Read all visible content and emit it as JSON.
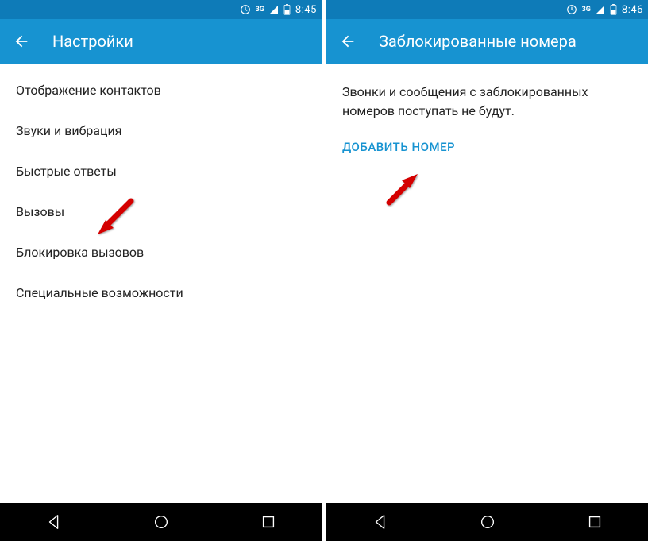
{
  "left": {
    "status": {
      "network": "3G",
      "time": "8:45"
    },
    "appbar": {
      "title": "Настройки"
    },
    "menu": [
      {
        "label": "Отображение контактов"
      },
      {
        "label": "Звуки и вибрация"
      },
      {
        "label": "Быстрые ответы"
      },
      {
        "label": "Вызовы"
      },
      {
        "label": "Блокировка вызовов"
      },
      {
        "label": "Специальные возможности"
      }
    ]
  },
  "right": {
    "status": {
      "network": "3G",
      "time": "8:46"
    },
    "appbar": {
      "title": "Заблокированные номера"
    },
    "description": "Звонки и сообщения с заблокированных номеров поступать не будут.",
    "action": "ДОБАВИТЬ НОМЕР"
  }
}
